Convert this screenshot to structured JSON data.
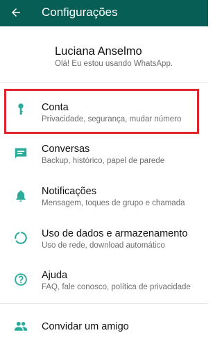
{
  "header": {
    "title": "Configurações"
  },
  "profile": {
    "name": "Luciana Anselmo",
    "status": "Olá! Eu estou usando WhatsApp."
  },
  "menu": {
    "account": {
      "label": "Conta",
      "sub": "Privacidade, segurança, mudar número",
      "icon": "key-icon"
    },
    "chats": {
      "label": "Conversas",
      "sub": "Backup, histórico, papel de parede",
      "icon": "chat-icon"
    },
    "notifications": {
      "label": "Notificações",
      "sub": "Mensagem, toques de grupo e chamada",
      "icon": "bell-icon"
    },
    "data": {
      "label": "Uso de dados e armazenamento",
      "sub": "Uso de rede, download automático",
      "icon": "data-usage-icon"
    },
    "help": {
      "label": "Ajuda",
      "sub": "FAQ, fale conosco, política de privacidade",
      "icon": "help-icon"
    },
    "invite": {
      "label": "Convidar um amigo",
      "icon": "people-icon"
    }
  },
  "colors": {
    "appbar": "#075e54",
    "icon_teal": "#2bab9a",
    "highlight_border": "#e0242b"
  }
}
